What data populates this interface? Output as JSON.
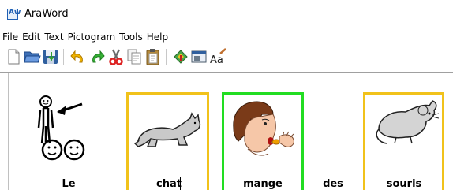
{
  "window": {
    "title": "AraWord",
    "icon": "araword-app-icon",
    "icon_text": "Aw"
  },
  "menubar": {
    "items": [
      "File",
      "Edit",
      "Text",
      "Pictogram",
      "Tools",
      "Help"
    ]
  },
  "toolbar": {
    "buttons": [
      {
        "name": "new-document-button",
        "icon": "new-document-icon"
      },
      {
        "name": "open-button",
        "icon": "open-folder-icon"
      },
      {
        "name": "save-button",
        "icon": "save-icon"
      },
      {
        "name": "undo-button",
        "icon": "undo-icon"
      },
      {
        "name": "redo-button",
        "icon": "redo-icon"
      },
      {
        "name": "cut-button",
        "icon": "scissors-icon"
      },
      {
        "name": "copy-button",
        "icon": "copy-icon"
      },
      {
        "name": "paste-button",
        "icon": "paste-icon"
      },
      {
        "name": "pictogram-tool-button",
        "icon": "pictogram-tool-icon"
      },
      {
        "name": "view-button",
        "icon": "window-icon"
      },
      {
        "name": "text-format-button",
        "icon": "text-format-icon",
        "label": "Aa"
      }
    ]
  },
  "document": {
    "words": [
      {
        "text": "Le",
        "frame": "none",
        "pictogram": "person-pointing-pictogram"
      },
      {
        "text": "chat",
        "frame": "yellow",
        "pictogram": "cat-pictogram",
        "has_caret": true
      },
      {
        "text": "mange",
        "frame": "green",
        "pictogram": "boy-eating-pictogram"
      },
      {
        "text": "des",
        "frame": "none",
        "pictogram": ""
      },
      {
        "text": "souris",
        "frame": "yellow",
        "pictogram": "mouse-pictogram"
      }
    ],
    "frame_colors": {
      "yellow": "#f1c21b",
      "green": "#22dd22"
    }
  }
}
